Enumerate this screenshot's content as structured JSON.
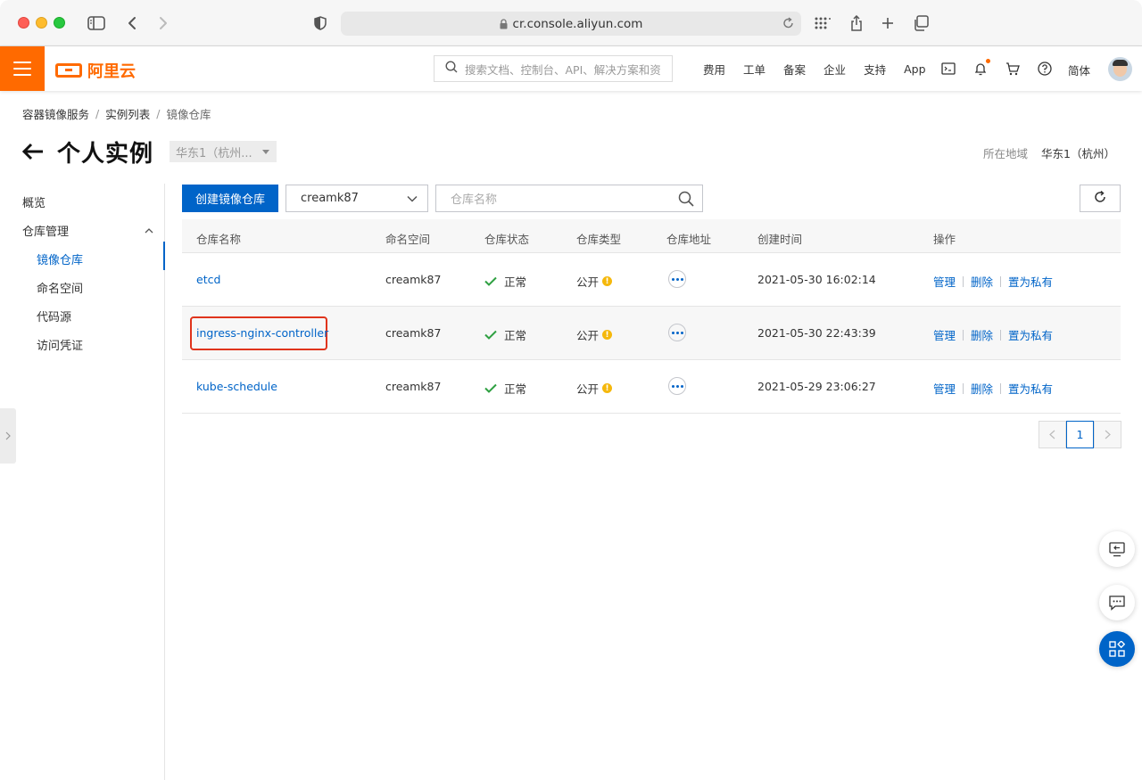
{
  "browser": {
    "url": "cr.console.aliyun.com"
  },
  "topnav": {
    "logo_text": "阿里云",
    "search_placeholder": "搜索文档、控制台、API、解决方案和资",
    "links": [
      "费用",
      "工单",
      "备案",
      "企业",
      "支持",
      "App"
    ],
    "lang": "简体"
  },
  "breadcrumb": {
    "items": [
      "容器镜像服务",
      "实例列表",
      "镜像仓库"
    ]
  },
  "header": {
    "title": "个人实例",
    "region_select": "华东1（杭州...",
    "region_label": "所在地域",
    "region_value": "华东1（杭州）"
  },
  "sidebar": {
    "overview": "概览",
    "repo_mgmt": "仓库管理",
    "items": [
      {
        "label": "镜像仓库",
        "active": true
      },
      {
        "label": "命名空间",
        "active": false
      },
      {
        "label": "代码源",
        "active": false
      },
      {
        "label": "访问凭证",
        "active": false
      }
    ]
  },
  "toolbar": {
    "create_label": "创建镜像仓库",
    "namespace_value": "creamk87",
    "search_placeholder": "仓库名称"
  },
  "table": {
    "headers": [
      "仓库名称",
      "命名空间",
      "仓库状态",
      "仓库类型",
      "仓库地址",
      "创建时间",
      "操作"
    ],
    "rows": [
      {
        "name": "etcd",
        "namespace": "creamk87",
        "status": "正常",
        "type": "公开",
        "created": "2021-05-30 16:02:14"
      },
      {
        "name": "ingress-nginx-controller",
        "namespace": "creamk87",
        "status": "正常",
        "type": "公开",
        "created": "2021-05-30 22:43:39"
      },
      {
        "name": "kube-schedule",
        "namespace": "creamk87",
        "status": "正常",
        "type": "公开",
        "created": "2021-05-29 23:06:27"
      }
    ],
    "actions": [
      "管理",
      "删除",
      "置为私有"
    ]
  },
  "pagination": {
    "current": "1"
  },
  "colors": {
    "accent": "#ff6a00",
    "primary": "#0064c8",
    "success": "#2fa042",
    "warning": "#f5b80c",
    "highlight_box": "#e0341c"
  }
}
